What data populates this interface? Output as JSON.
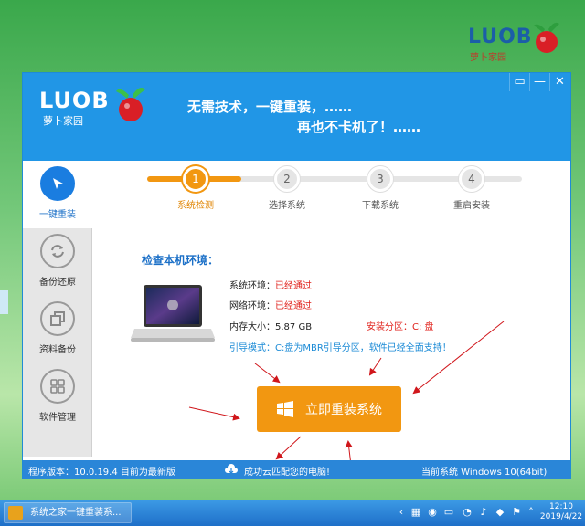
{
  "desktop": {
    "logo_text": "LUOB",
    "logo_sub": "萝卜家园"
  },
  "window": {
    "logo_text": "LUOB",
    "logo_sub": "萝卜家园",
    "slogan_line1": "无需技术，一键重装，……",
    "slogan_line2": "再也不卡机了！……",
    "controls": {
      "feedback": "▭",
      "minimize": "—",
      "close": "✕"
    }
  },
  "sidebar": {
    "items": [
      {
        "label": "一键重装",
        "icon": "cursor-icon",
        "active": true
      },
      {
        "label": "备份还原",
        "icon": "refresh-icon",
        "active": false
      },
      {
        "label": "资料备份",
        "icon": "copy-icon",
        "active": false
      },
      {
        "label": "软件管理",
        "icon": "grid-icon",
        "active": false
      }
    ]
  },
  "steps": [
    {
      "num": "1",
      "label": "系统检测",
      "active": true
    },
    {
      "num": "2",
      "label": "选择系统",
      "active": false
    },
    {
      "num": "3",
      "label": "下载系统",
      "active": false
    },
    {
      "num": "4",
      "label": "重启安装",
      "active": false
    }
  ],
  "progress_fraction": 0.25,
  "env": {
    "title": "检查本机环境：",
    "system_label": "系统环境：",
    "system_value": "已经通过",
    "network_label": "网络环境：",
    "network_value": "已经通过",
    "memory_label": "内存大小：",
    "memory_value": "5.87 GB",
    "partition_label": "安装分区：",
    "partition_value": "C: 盘",
    "boot_hint": "引导模式：C:盘为MBR引导分区，软件已经全面支持！"
  },
  "install_button": "立即重装系统",
  "status": {
    "version": "程序版本：10.0.19.4 目前为最新版",
    "cloud": "成功云匹配您的电脑!",
    "current_os": "当前系统 Windows 10(64bit)"
  },
  "taskbar": {
    "app_label": "系统之家一键重装系...",
    "time": "12:10",
    "date": "2019/4/22"
  },
  "colors": {
    "accent_blue": "#2196e6",
    "accent_orange": "#f29711",
    "pass_red": "#e0221c"
  }
}
